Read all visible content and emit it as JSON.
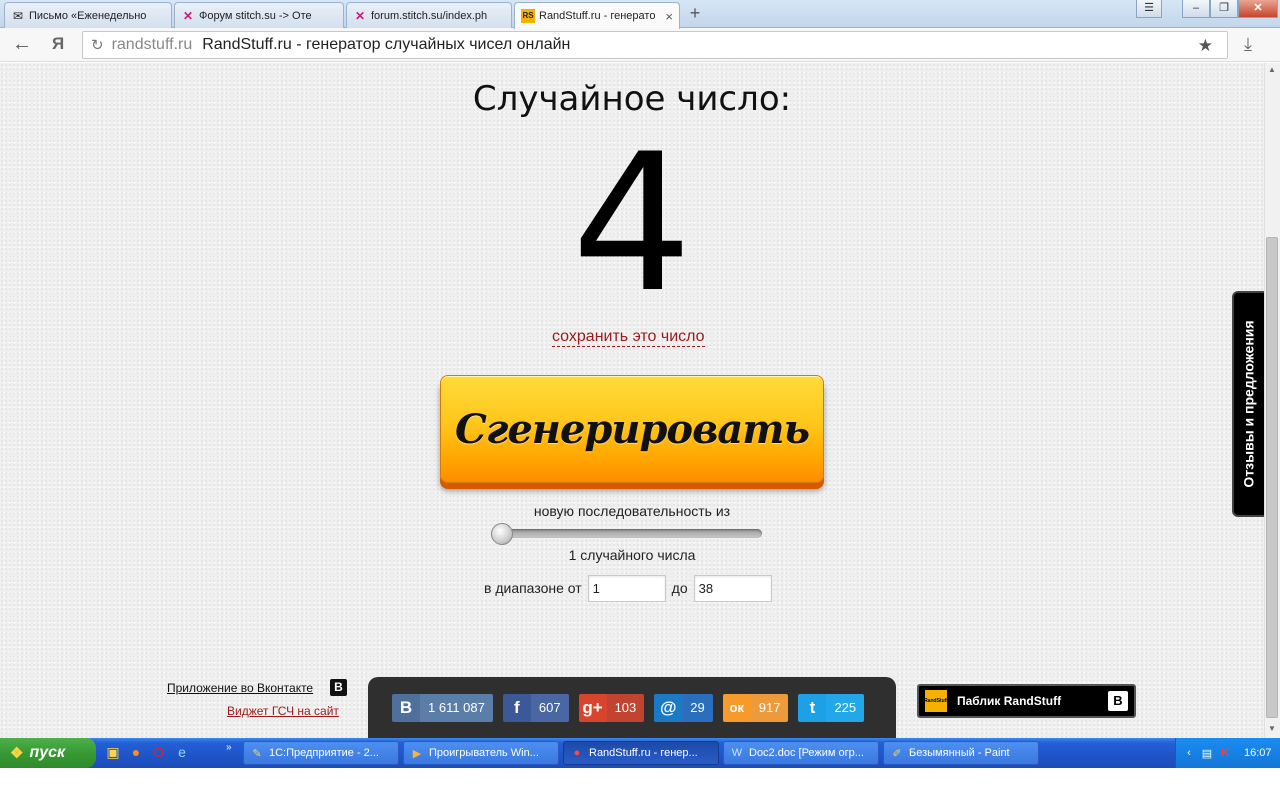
{
  "browser": {
    "tabs": [
      {
        "title": "Письмо «Еженедельно",
        "icon": "mail-icon",
        "active": false
      },
      {
        "title": "Форум stitch.su -> Оте",
        "icon": "stitch-icon",
        "active": false
      },
      {
        "title": "forum.stitch.su/index.ph",
        "icon": "stitch-icon",
        "active": false
      },
      {
        "title": "RandStuff.ru - генерато",
        "icon": "randstuff-icon",
        "active": true
      }
    ],
    "new_tab_label": "+",
    "address": {
      "domain": "randstuff.ru",
      "title": "RandStuff.ru - генератор случайных чисел онлайн"
    },
    "yandex_label": "Я"
  },
  "page": {
    "heading": "Случайное число:",
    "number": "4",
    "save_link": "сохранить это число",
    "generate_label": "Сгенерировать",
    "sequence_label": "новую последовательность из",
    "slider_value": 1,
    "count_label": "1 случайного числа",
    "range": {
      "from_label": "в диапазоне от",
      "from_value": "1",
      "to_label": "до",
      "to_value": "38"
    },
    "feedback_tab": "Отзывы и предложения",
    "footer": {
      "vk_app_link": "Приложение во Вконтакте",
      "vk_icon_letter": "В",
      "widget_link": "Виджет ГСЧ на сайт",
      "share": [
        {
          "network": "vkontakte",
          "icon": "vk-icon",
          "glyph": "В",
          "count": "1 611 087",
          "color": "#4f709b",
          "count_color": "#5b7ea8"
        },
        {
          "network": "facebook",
          "icon": "facebook-icon",
          "glyph": "f",
          "count": "607",
          "color": "#3b5998",
          "count_color": "#4a66a3"
        },
        {
          "network": "googleplus",
          "icon": "google-plus-icon",
          "glyph": "g+",
          "count": "103",
          "color": "#d8442c",
          "count_color": "#c2432f"
        },
        {
          "network": "mailru",
          "icon": "mailru-icon",
          "glyph": "@",
          "count": "29",
          "color": "#1a7ac6",
          "count_color": "#2a6ebc"
        },
        {
          "network": "odnoklassniki",
          "icon": "odnoklassniki-icon",
          "glyph": "ок",
          "count": "917",
          "color": "#f59a2b",
          "count_color": "#ec9a3a"
        },
        {
          "network": "twitter",
          "icon": "twitter-icon",
          "glyph": "t",
          "count": "225",
          "color": "#1da0e6",
          "count_color": "#22a8ea"
        }
      ],
      "public_label": "Паблик RandStuff",
      "public_logo_text": "RandStuff",
      "public_vk_letter": "В"
    }
  },
  "taskbar": {
    "start_label": "пуск",
    "quicklaunch": [
      "explorer-icon",
      "firefox-icon",
      "opera-icon",
      "ie-icon"
    ],
    "tasks": [
      {
        "label": "1С:Предприятие - 2...",
        "icon": "1c-icon",
        "active": false
      },
      {
        "label": "Проигрыватель Win...",
        "icon": "media-player-icon",
        "active": false
      },
      {
        "label": "RandStuff.ru - генер...",
        "icon": "yandex-browser-icon",
        "active": true
      },
      {
        "label": "Doc2.doc [Режим огр...",
        "icon": "word-icon",
        "active": false
      },
      {
        "label": "Безымянный - Paint",
        "icon": "paint-icon",
        "active": false
      }
    ],
    "clock": "16:07"
  }
}
